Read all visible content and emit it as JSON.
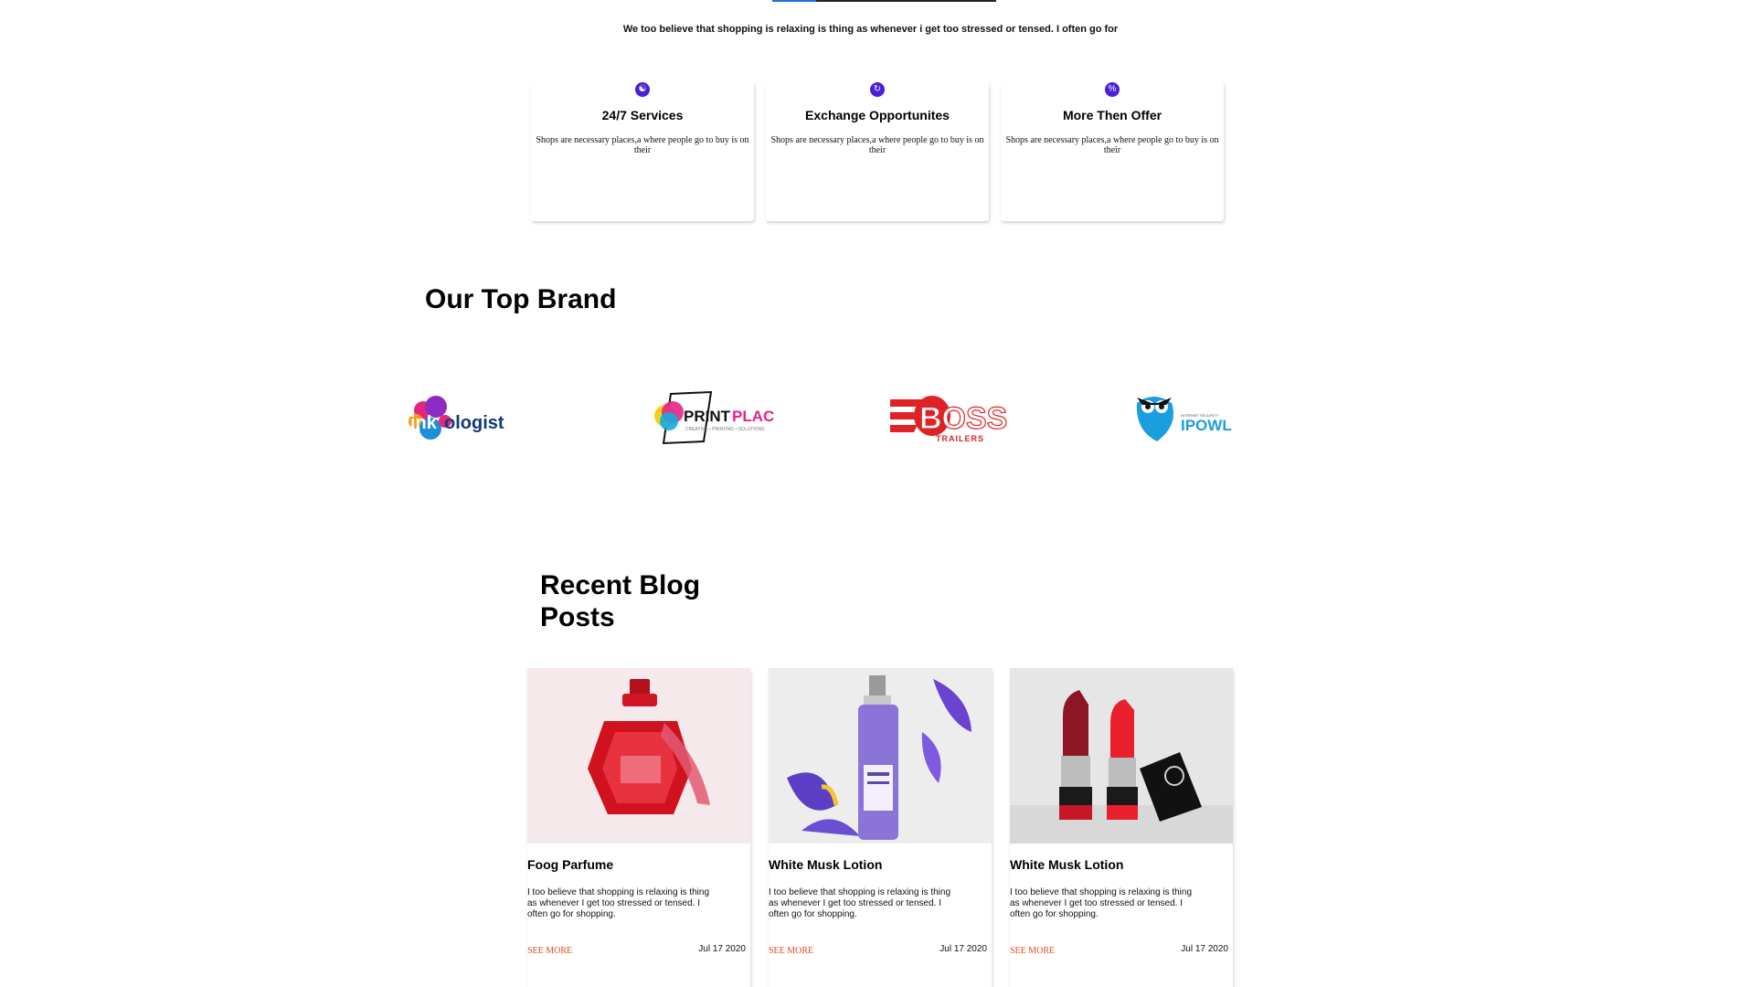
{
  "tagline": "We too believe that shopping is relaxing is thing as whenever i get too stressed or tensed. I often go for",
  "services": [
    {
      "icon": "hand-person-icon",
      "title": "24/7 Services",
      "description": "Shops are necessary places,a where people go to buy is on their"
    },
    {
      "icon": "exchange-icon",
      "title": "Exchange Opportunites",
      "description": "Shops are necessary places,a where people go to buy is on their"
    },
    {
      "icon": "percent-icon",
      "title": "More Then Offer",
      "description": "Shops are necessary places,a where people go to buy is on their"
    }
  ],
  "brands": {
    "heading": "Our Top Brand",
    "logos": [
      {
        "name": "inkologist-logo",
        "text_a": "ink",
        "text_b": "ologist"
      },
      {
        "name": "print-place-logo",
        "text": "PRINT PLACE",
        "subtext": "CREATIVE • PRINTING • SOLUTIONS"
      },
      {
        "name": "boss-trailers-logo",
        "text": "BOSS",
        "subtext": "TRAILERS"
      },
      {
        "name": "ipowl-logo",
        "text": "IPOWL",
        "subtext": "INTERNET SECURITY"
      }
    ]
  },
  "blog": {
    "heading": "Recent Blog Posts",
    "posts": [
      {
        "image": "red-perfume-bottle",
        "title": "Foog Parfume",
        "text": "I too believe that shopping is relaxing is thing as whenever I get too stressed or tensed. I often go for shopping.",
        "link": "SEE MORE",
        "date": "Jul 17 2020"
      },
      {
        "image": "white-musk-spray-bottle",
        "title": "White Musk Lotion",
        "text": "I too believe that shopping is relaxing is thing as whenever I get too stressed or tensed. I often go for shopping.",
        "link": "SEE MORE",
        "date": "Jul 17 2020"
      },
      {
        "image": "red-lipsticks",
        "title": "White Musk Lotion",
        "text": "I too believe that shopping is relaxing is thing as whenever I get too stressed or tensed. I often go for shopping.",
        "link": "SEE MORE",
        "date": "Jul 17 2020"
      }
    ]
  },
  "colors": {
    "accent": "#4b1fd9",
    "link": "#e8481c"
  }
}
